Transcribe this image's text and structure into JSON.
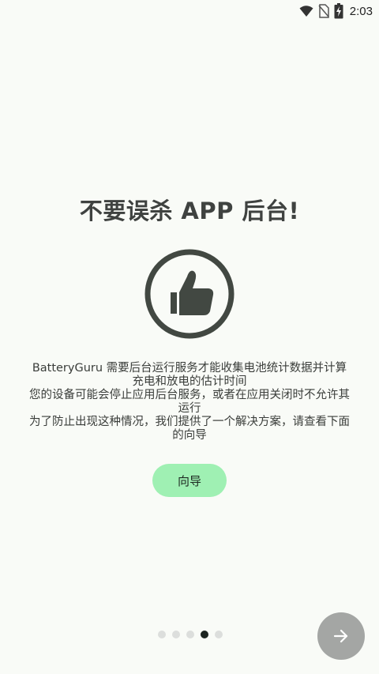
{
  "status_bar": {
    "time": "2:03",
    "icons": [
      "wifi-icon",
      "no-sim-icon",
      "battery-charging-icon"
    ]
  },
  "title": "不要误杀 APP 后台!",
  "illustration": "thumbs-up-icon",
  "description": {
    "lines": [
      "BatteryGuru 需要后台运行服务才能收集电池统计数据并计算充电和放电的估计时间",
      "您的设备可能会停止应用后台服务，或者在应用关闭时不允许其运行",
      "为了防止出现这种情况，我们提供了一个解决方案，请查看下面的向导"
    ]
  },
  "guide_button": {
    "label": "向导"
  },
  "pager": {
    "total": 5,
    "current": 4
  },
  "next_button": {
    "icon": "arrow-right-icon"
  },
  "colors": {
    "background": "#f9fbf7",
    "accent": "#9ff0b3",
    "icon": "#424842",
    "next_button": "#a4a6a4"
  }
}
